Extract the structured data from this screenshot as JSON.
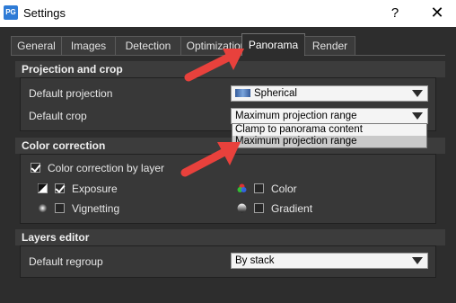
{
  "window": {
    "app_icon": "app-icon",
    "title": "Settings",
    "help": "?",
    "close": "✕"
  },
  "tabs": [
    {
      "label": "General"
    },
    {
      "label": "Images"
    },
    {
      "label": "Detection"
    },
    {
      "label": "Optimization"
    },
    {
      "label": "Panorama"
    },
    {
      "label": "Render"
    }
  ],
  "active_tab": "Panorama",
  "projection_crop": {
    "header": "Projection and crop",
    "projection_label": "Default projection",
    "projection_value": "Spherical",
    "crop_label": "Default crop",
    "crop_value": "Maximum projection range",
    "crop_options": [
      "Clamp to panorama content",
      "Maximum projection range"
    ]
  },
  "color_correction": {
    "header": "Color correction",
    "by_layer_label": "Color correction by layer",
    "exposure_label": "Exposure",
    "color_label": "Color",
    "vignetting_label": "Vignetting",
    "gradient_label": "Gradient"
  },
  "layers_editor": {
    "header": "Layers editor",
    "regroup_label": "Default regroup",
    "regroup_value": "By stack"
  },
  "annotation_color": "#e8413c"
}
